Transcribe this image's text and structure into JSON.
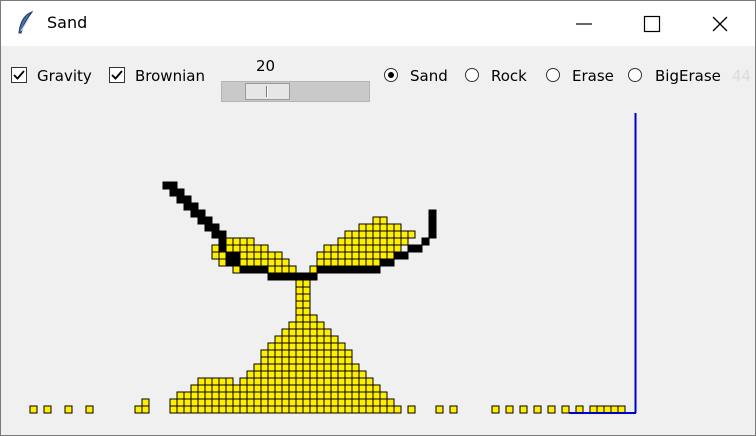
{
  "window": {
    "title": "Sand"
  },
  "controls": {
    "gravity": {
      "label": "Gravity",
      "checked": true
    },
    "brownian": {
      "label": "Brownian",
      "checked": true
    },
    "speed": {
      "value": "20",
      "min": 0,
      "max": 100,
      "level": 20
    },
    "tools": [
      {
        "label": "Sand",
        "selected": true
      },
      {
        "label": "Rock",
        "selected": false
      },
      {
        "label": "Erase",
        "selected": false
      },
      {
        "label": "BigErase",
        "selected": false
      }
    ],
    "counter": "44"
  },
  "colors": {
    "sand": "#ffee00",
    "rock": "#000000",
    "boundary": "#0000cc"
  }
}
